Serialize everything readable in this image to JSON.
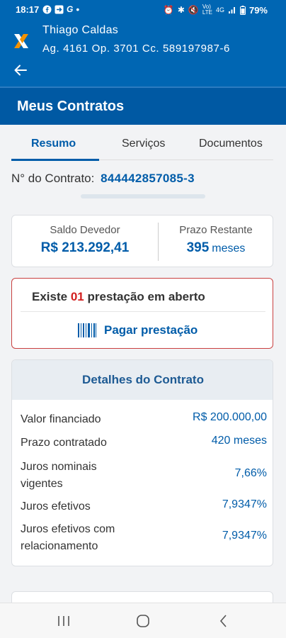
{
  "status_bar": {
    "time": "18:17",
    "left_icons": [
      "facebook-icon",
      "export-icon",
      "google-icon",
      "dot-icon"
    ],
    "right_icons": [
      "alarm-icon",
      "bluetooth-icon",
      "mute-icon",
      "volte-icon",
      "signal-icon"
    ],
    "network_label": "4G",
    "lte_label": "LTE",
    "battery": "79%"
  },
  "header": {
    "user_name": "Thiago Caldas",
    "account": "Ag. 4161  Op. 3701  Cc. 589197987-6",
    "back_icon": "arrow-left-icon",
    "logo_icon": "caixa-x-logo"
  },
  "page_title": "Meus Contratos",
  "tabs": [
    {
      "label": "Resumo",
      "active": true
    },
    {
      "label": "Serviços",
      "active": false
    },
    {
      "label": "Documentos",
      "active": false
    }
  ],
  "contract": {
    "label": "N° do Contrato:",
    "number": "844442857085-3"
  },
  "summary": {
    "saldo_label": "Saldo Devedor",
    "saldo_value": "R$ 213.292,41",
    "prazo_label": "Prazo Restante",
    "prazo_value": "395",
    "prazo_unit": "meses"
  },
  "alert": {
    "prefix": "Existe",
    "count": "01",
    "suffix": "prestação em aberto",
    "pay_label": "Pagar prestação",
    "pay_icon": "barcode-icon"
  },
  "details": {
    "title": "Detalhes do Contrato",
    "rows": [
      {
        "label": "Valor financiado",
        "value": "R$ 200.000,00"
      },
      {
        "label": "Prazo contratado",
        "value": "420 meses"
      },
      {
        "label": "Juros nominais vigentes",
        "value": "7,66%"
      },
      {
        "label": "Juros efetivos",
        "value": "7,9347%"
      },
      {
        "label": "Juros efetivos com relacionamento",
        "value": "7,9347%"
      }
    ]
  },
  "nav": [
    "recent-apps-icon",
    "home-icon",
    "back-nav-icon"
  ],
  "colors": {
    "brand_blue": "#0066b3",
    "title_blue": "#0059a3",
    "accent_blue": "#005ca9",
    "alert_red": "#d21f1f",
    "logo_orange": "#f39200"
  }
}
